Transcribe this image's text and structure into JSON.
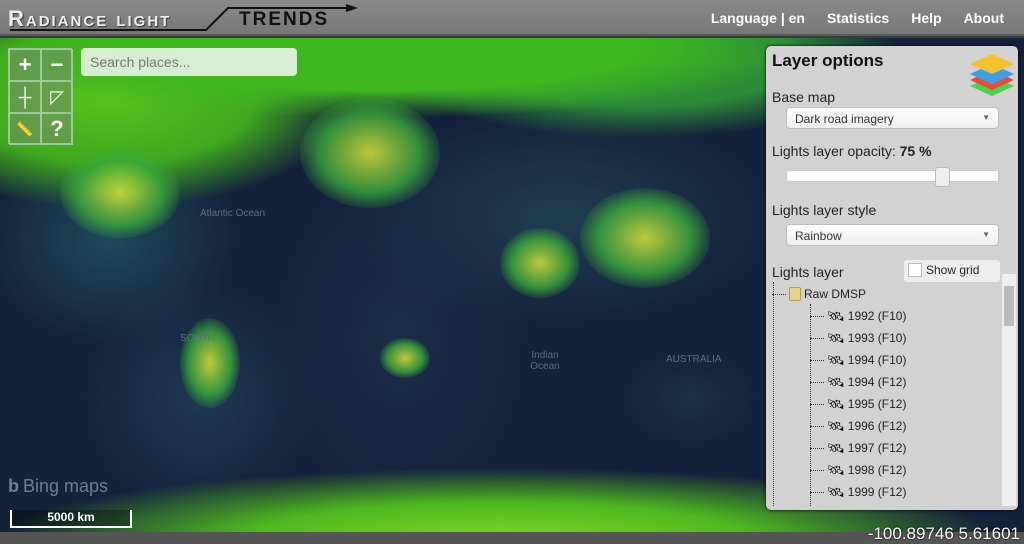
{
  "header": {
    "logo_text_1": "Radiance light",
    "logo_text_2": "TRENDS",
    "nav": [
      "Language | en",
      "Statistics",
      "Help",
      "About"
    ]
  },
  "map": {
    "search_placeholder": "Search places...",
    "tools": [
      "zoom-in",
      "zoom-out",
      "locate",
      "draw-polygon",
      "measure",
      "help"
    ],
    "tool_glyphs": [
      "+",
      "−",
      "┼",
      "◸",
      "📏",
      "?"
    ],
    "labels": [
      "Atlantic Ocean",
      "SOUTH",
      "Indian Ocean",
      "AUSTRALIA"
    ],
    "attribution": "Bing maps",
    "scale": "5000 km",
    "coordinates": "-100.89746 5.61601"
  },
  "panel": {
    "title": "Layer options",
    "base_map_label": "Base map",
    "base_map_value": "Dark road imagery",
    "opacity_label": "Lights layer opacity:",
    "opacity_value": "75 %",
    "opacity": 75,
    "style_label": "Lights layer style",
    "style_value": "Rainbow",
    "lights_layer_label": "Lights layer",
    "show_grid_label": "Show grid",
    "show_grid_checked": false,
    "tree": {
      "root": "Raw DMSP",
      "items": [
        "1992 (F10)",
        "1993 (F10)",
        "1994 (F10)",
        "1994 (F12)",
        "1995 (F12)",
        "1996 (F12)",
        "1997 (F12)",
        "1998 (F12)",
        "1999 (F12)"
      ]
    }
  }
}
